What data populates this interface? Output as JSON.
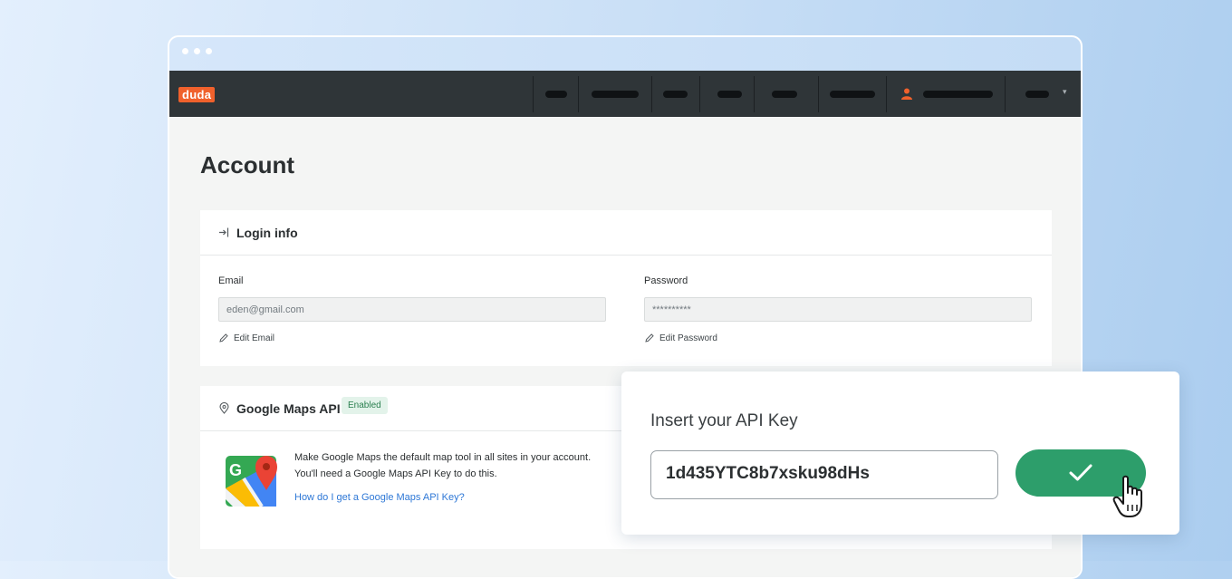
{
  "navbar": {
    "logo": "duda"
  },
  "page": {
    "title": "Account"
  },
  "login_info": {
    "title": "Login info",
    "email_label": "Email",
    "email_value": "eden@gmail.com",
    "edit_email": "Edit Email",
    "password_label": "Password",
    "password_value": "**********",
    "edit_password": "Edit Password"
  },
  "google_maps": {
    "title": "Google Maps API",
    "badge": "Enabled",
    "description_line1": "Make Google Maps the default map tool in all sites in your account.",
    "description_line2": "You'll need a Google Maps API Key to do this.",
    "help_link": "How do I get a Google Maps API Key?"
  },
  "api_popup": {
    "label": "Insert your API Key",
    "api_key_value": "1d435YTC8b7xsku98dHs"
  },
  "colors": {
    "brand": "#f0612c",
    "navbar": "#2f3538",
    "confirm": "#2d9e6b",
    "link": "#2d77d6"
  }
}
